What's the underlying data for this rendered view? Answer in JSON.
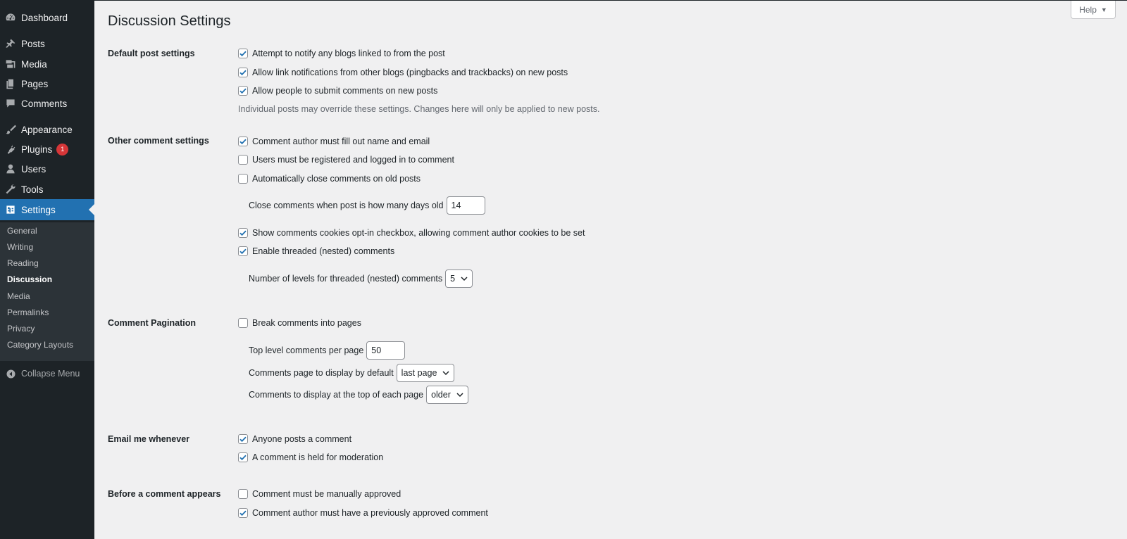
{
  "sidebar": {
    "menu": [
      {
        "label": "Dashboard",
        "icon": "dashboard-icon"
      },
      {
        "label": "Posts",
        "icon": "pin-icon"
      },
      {
        "label": "Media",
        "icon": "media-icon"
      },
      {
        "label": "Pages",
        "icon": "pages-icon"
      },
      {
        "label": "Comments",
        "icon": "comment-icon"
      },
      {
        "label": "Appearance",
        "icon": "brush-icon"
      },
      {
        "label": "Plugins",
        "icon": "plugin-icon",
        "badge": "1"
      },
      {
        "label": "Users",
        "icon": "user-icon"
      },
      {
        "label": "Tools",
        "icon": "wrench-icon"
      },
      {
        "label": "Settings",
        "icon": "settings-icon"
      }
    ],
    "submenu": [
      "General",
      "Writing",
      "Reading",
      "Discussion",
      "Media",
      "Permalinks",
      "Privacy",
      "Category Layouts"
    ],
    "current_submenu": "Discussion",
    "collapse_label": "Collapse Menu"
  },
  "help": {
    "label": "Help"
  },
  "page": {
    "title": "Discussion Settings"
  },
  "sections": {
    "default_post": {
      "label": "Default post settings",
      "options": [
        {
          "label": "Attempt to notify any blogs linked to from the post",
          "checked": true
        },
        {
          "label": "Allow link notifications from other blogs (pingbacks and trackbacks) on new posts",
          "checked": true
        },
        {
          "label": "Allow people to submit comments on new posts",
          "checked": true
        }
      ],
      "description": "Individual posts may override these settings. Changes here will only be applied to new posts."
    },
    "other_comment": {
      "label": "Other comment settings",
      "options": [
        {
          "label": "Comment author must fill out name and email",
          "checked": true
        },
        {
          "label": "Users must be registered and logged in to comment",
          "checked": false
        },
        {
          "label": "Automatically close comments on old posts",
          "checked": false
        },
        {
          "label": "Show comments cookies opt-in checkbox, allowing comment author cookies to be set",
          "checked": true
        },
        {
          "label": "Enable threaded (nested) comments",
          "checked": true
        }
      ],
      "close_days_label": "Close comments when post is how many days old",
      "close_days_value": "14",
      "thread_levels_label": "Number of levels for threaded (nested) comments",
      "thread_levels_value": "5"
    },
    "pagination": {
      "label": "Comment Pagination",
      "options": [
        {
          "label": "Break comments into pages",
          "checked": false
        }
      ],
      "per_page_label": "Top level comments per page",
      "per_page_value": "50",
      "default_page_label": "Comments page to display by default",
      "default_page_value": "last page",
      "order_label": "Comments to display at the top of each page",
      "order_value": "older"
    },
    "email": {
      "label": "Email me whenever",
      "options": [
        {
          "label": "Anyone posts a comment",
          "checked": true
        },
        {
          "label": "A comment is held for moderation",
          "checked": true
        }
      ]
    },
    "before_appears": {
      "label": "Before a comment appears",
      "options": [
        {
          "label": "Comment must be manually approved",
          "checked": false
        },
        {
          "label": "Comment author must have a previously approved comment",
          "checked": true
        }
      ]
    }
  },
  "colors": {
    "sidebar_bg": "#1d2327",
    "submenu_bg": "#2c3338",
    "accent": "#2271b1",
    "badge": "#d63638",
    "page_bg": "#f0f0f1"
  }
}
